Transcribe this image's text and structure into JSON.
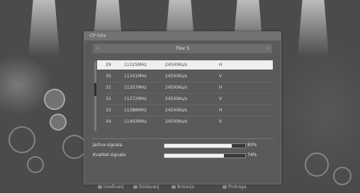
{
  "panel": {
    "title": "CP lista",
    "satellite": "Thor 5",
    "arrow_left": "‹",
    "arrow_right": "›"
  },
  "channels": [
    {
      "num": "29",
      "freq": "11325MHz",
      "sr": "24500Ks/s",
      "pol": "H"
    },
    {
      "num": "30",
      "freq": "11341MHz",
      "sr": "24500Ks/s",
      "pol": "V"
    },
    {
      "num": "31",
      "freq": "11357MHz",
      "sr": "24500Ks/s",
      "pol": "H"
    },
    {
      "num": "32",
      "freq": "11372MHz",
      "sr": "24500Ks/s",
      "pol": "V"
    },
    {
      "num": "33",
      "freq": "11388MHz",
      "sr": "24500Ks/s",
      "pol": "H"
    },
    {
      "num": "34",
      "freq": "11403MHz",
      "sr": "24500Ks/s",
      "pol": "V"
    }
  ],
  "signal": {
    "strength_label": "Jačina signala",
    "strength_pct": "83%",
    "strength_value": 83,
    "quality_label": "Kvalitet signala",
    "quality_pct": "74%",
    "quality_value": 74
  },
  "footer": {
    "edit": "Uređivanj",
    "add": "Dodavanj",
    "delete": "Brisanje",
    "search": "Pretraga"
  }
}
